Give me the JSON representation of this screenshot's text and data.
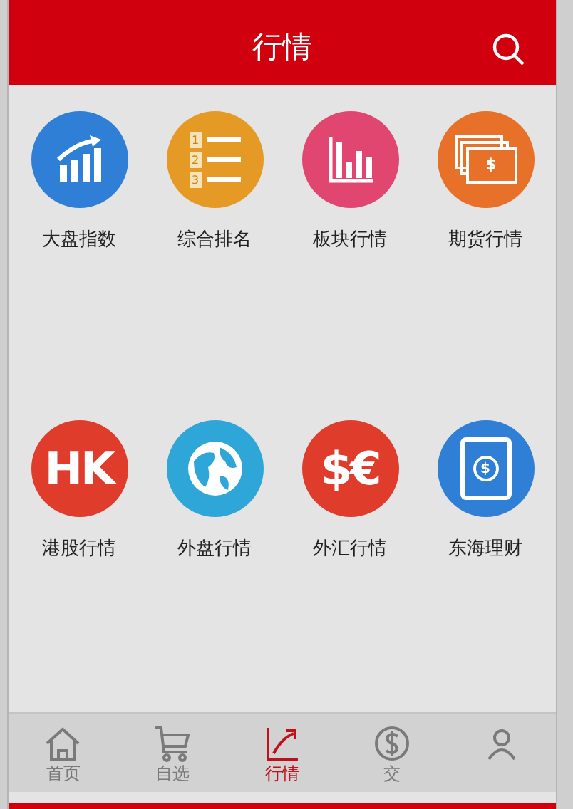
{
  "header": {
    "title": "行情"
  },
  "grid": [
    {
      "kind": "index",
      "label": "大盘指数",
      "color": "#2f7fd6"
    },
    {
      "kind": "ranking",
      "label": "综合排名",
      "color": "#e59a25",
      "numbers": [
        "1",
        "2",
        "3"
      ]
    },
    {
      "kind": "sector",
      "label": "板块行情",
      "color": "#e0466f"
    },
    {
      "kind": "futures",
      "label": "期货行情",
      "color": "#e8712a",
      "glyph": "$"
    },
    {
      "kind": "hk",
      "label": "港股行情",
      "color": "#e03c2c",
      "glyph": "HK"
    },
    {
      "kind": "globe",
      "label": "外盘行情",
      "color": "#2ea6d8"
    },
    {
      "kind": "fx",
      "label": "外汇行情",
      "color": "#e03c2c",
      "glyph": "$€"
    },
    {
      "kind": "wealth",
      "label": "东海理财",
      "color": "#2f7fd6",
      "glyph": "$"
    }
  ],
  "tabs": [
    {
      "kind": "home",
      "label": "首页",
      "selected": false
    },
    {
      "kind": "cart",
      "label": "自选",
      "selected": false
    },
    {
      "kind": "trend",
      "label": "行情",
      "selected": true
    },
    {
      "kind": "trade",
      "label": "交",
      "selected": false
    },
    {
      "kind": "user",
      "selected": false
    }
  ]
}
